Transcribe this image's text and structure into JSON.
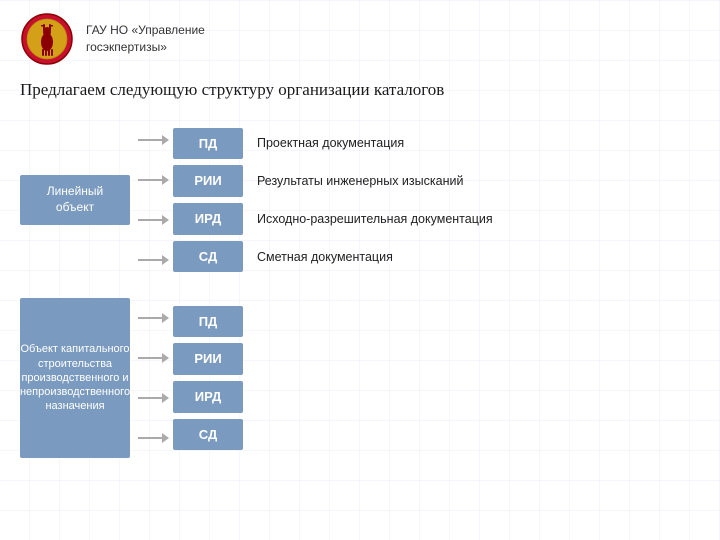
{
  "header": {
    "org_name_line1": "ГАУ НО «Управление",
    "org_name_line2": "госэкпертизы»"
  },
  "page_title": "Предлагаем следующую структуру организации каталогов",
  "section1": {
    "left_label": "Линейный объект",
    "items": [
      {
        "code": "ПД",
        "desc": "Проектная документация"
      },
      {
        "code": "РИИ",
        "desc": "Результаты инженерных изысканий"
      },
      {
        "code": "ИРД",
        "desc": "Исходно-разрешительная документация"
      },
      {
        "code": "СД",
        "desc": "Сметная документация"
      }
    ]
  },
  "section2": {
    "left_label": "Объект капитального строительства производственного и непроизводственного назначения",
    "items": [
      {
        "code": "ПД"
      },
      {
        "code": "РИИ"
      },
      {
        "code": "ИРД"
      },
      {
        "code": "СД"
      }
    ]
  }
}
